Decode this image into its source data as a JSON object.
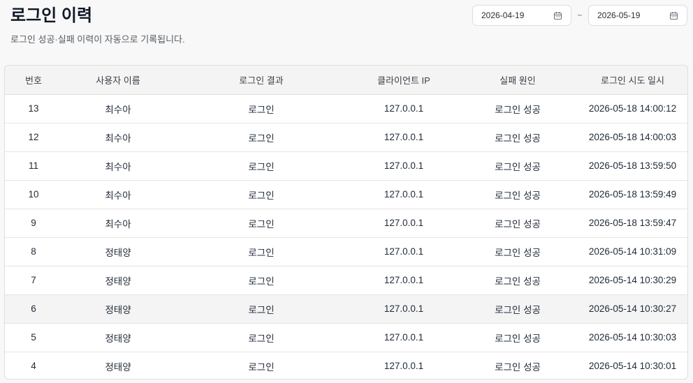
{
  "header": {
    "title": "로그인 이력",
    "subtitle": "로그인 성공·실패 이력이 자동으로 기록됩니다."
  },
  "date_range": {
    "start": "2026-04-19",
    "separator": "~",
    "end": "2026-05-19",
    "icon": "calendar-icon"
  },
  "table": {
    "columns": [
      "번호",
      "사용자 이름",
      "로그인 결과",
      "클라이언트 IP",
      "실패 원인",
      "로그인 시도 일시"
    ],
    "rows": [
      {
        "no": "13",
        "user": "최수아",
        "result": "로그인",
        "ip": "127.0.0.1",
        "reason": "로그인 성공",
        "time": "2026-05-18 14:00:12"
      },
      {
        "no": "12",
        "user": "최수아",
        "result": "로그인",
        "ip": "127.0.0.1",
        "reason": "로그인 성공",
        "time": "2026-05-18 14:00:03"
      },
      {
        "no": "11",
        "user": "최수아",
        "result": "로그인",
        "ip": "127.0.0.1",
        "reason": "로그인 성공",
        "time": "2026-05-18 13:59:50"
      },
      {
        "no": "10",
        "user": "최수아",
        "result": "로그인",
        "ip": "127.0.0.1",
        "reason": "로그인 성공",
        "time": "2026-05-18 13:59:49"
      },
      {
        "no": "9",
        "user": "최수아",
        "result": "로그인",
        "ip": "127.0.0.1",
        "reason": "로그인 성공",
        "time": "2026-05-18 13:59:47"
      },
      {
        "no": "8",
        "user": "정태양",
        "result": "로그인",
        "ip": "127.0.0.1",
        "reason": "로그인 성공",
        "time": "2026-05-14 10:31:09"
      },
      {
        "no": "7",
        "user": "정태양",
        "result": "로그인",
        "ip": "127.0.0.1",
        "reason": "로그인 성공",
        "time": "2026-05-14 10:30:29"
      },
      {
        "no": "6",
        "user": "정태양",
        "result": "로그인",
        "ip": "127.0.0.1",
        "reason": "로그인 성공",
        "time": "2026-05-14 10:30:27"
      },
      {
        "no": "5",
        "user": "정태양",
        "result": "로그인",
        "ip": "127.0.0.1",
        "reason": "로그인 성공",
        "time": "2026-05-14 10:30:03"
      },
      {
        "no": "4",
        "user": "정태양",
        "result": "로그인",
        "ip": "127.0.0.1",
        "reason": "로그인 성공",
        "time": "2026-05-14 10:30:01"
      }
    ]
  }
}
